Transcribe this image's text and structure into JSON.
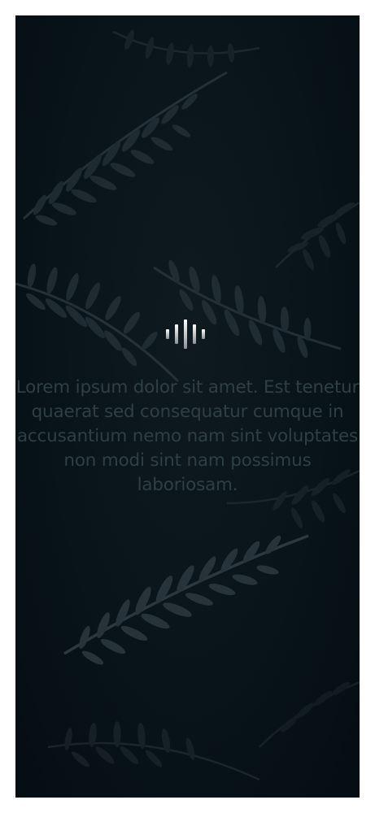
{
  "splash": {
    "logo_icon": "sound-wave-icon",
    "tagline": "Lorem ipsum dolor sit amet. Est tenetur quaerat sed consequatur cumque in accusantium nemo nam sint voluptates non modi sint nam possimus laboriosam.",
    "background": "dark fern leaves"
  },
  "colors": {
    "background": "#08141a",
    "tagline": "#2f3f46",
    "logo_light": "#ffffff",
    "logo_dark": "#8a9296"
  }
}
